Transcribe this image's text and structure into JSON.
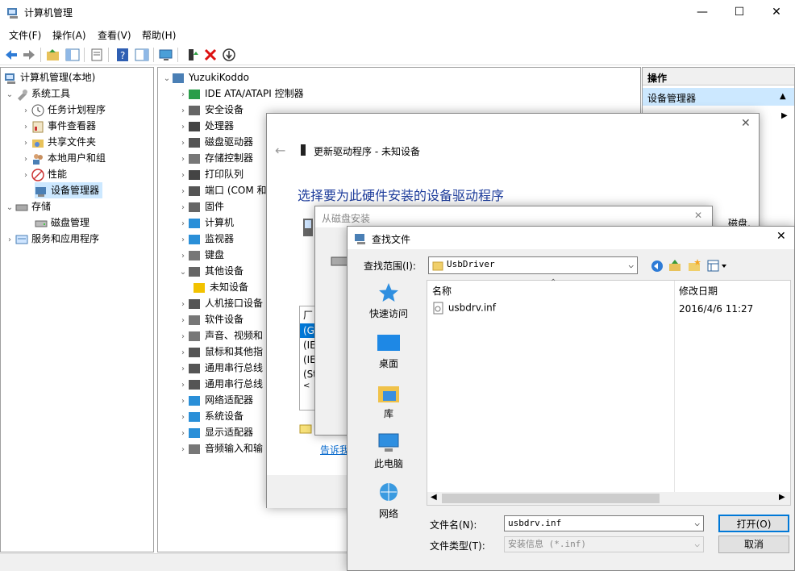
{
  "window": {
    "title": "计算机管理",
    "min": "—",
    "max": "☐",
    "close": "✕"
  },
  "menu": [
    "文件(F)",
    "操作(A)",
    "查看(V)",
    "帮助(H)"
  ],
  "left_tree": [
    {
      "label": "计算机管理(本地)",
      "icon": "computer-management-icon"
    },
    {
      "label": "系统工具",
      "icon": "tools-icon"
    },
    {
      "label": "任务计划程序",
      "icon": "clock-icon"
    },
    {
      "label": "事件查看器",
      "icon": "event-viewer-icon"
    },
    {
      "label": "共享文件夹",
      "icon": "shared-folder-icon"
    },
    {
      "label": "本地用户和组",
      "icon": "users-icon"
    },
    {
      "label": "性能",
      "icon": "performance-icon"
    },
    {
      "label": "设备管理器",
      "icon": "device-manager-icon"
    },
    {
      "label": "存储",
      "icon": "storage-icon"
    },
    {
      "label": "磁盘管理",
      "icon": "disk-icon"
    },
    {
      "label": "服务和应用程序",
      "icon": "services-icon"
    }
  ],
  "device_tree": {
    "root": "YuzukiKoddo",
    "items": [
      "IDE ATA/ATAPI 控制器",
      "安全设备",
      "处理器",
      "磁盘驱动器",
      "存储控制器",
      "打印队列",
      "端口 (COM 和",
      "固件",
      "计算机",
      "监视器",
      "键盘",
      "其他设备",
      "未知设备",
      "人机接口设备",
      "软件设备",
      "声音、视频和",
      "鼠标和其他指",
      "通用串行总线",
      "通用串行总线",
      "网络适配器",
      "系统设备",
      "显示适配器",
      "音频输入和输"
    ]
  },
  "actions": {
    "header": "操作",
    "section": "设备管理器"
  },
  "update_driver": {
    "title": "更新驱动程序 - 未知设备",
    "heading": "选择要为此硬件安装的设备驱动程序",
    "right_text": "磁盘,",
    "list_header": "厂",
    "list_items": [
      "(G",
      "(IE",
      "(IE",
      "(St"
    ],
    "link": "告诉我"
  },
  "from_disk": {
    "title": "从磁盘安装"
  },
  "find_file": {
    "title": "查找文件",
    "lookin_label": "查找范围(I):",
    "lookin_value": "UsbDriver",
    "places": [
      "快速访问",
      "桌面",
      "库",
      "此电脑",
      "网络"
    ],
    "col_name": "名称",
    "col_date": "修改日期",
    "files": [
      {
        "name": "usbdrv.inf",
        "date": "2016/4/6 11:27"
      }
    ],
    "filename_label": "文件名(N):",
    "filename_value": "usbdrv.inf",
    "filetype_label": "文件类型(T):",
    "filetype_value": "安装信息 (*.inf)",
    "open": "打开(O)",
    "cancel": "取消"
  }
}
